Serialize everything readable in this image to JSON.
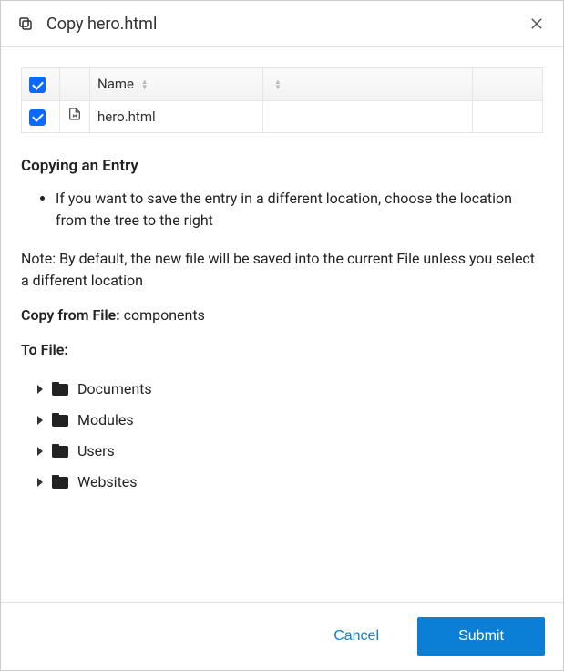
{
  "dialog": {
    "title": "Copy hero.html"
  },
  "table": {
    "headers": {
      "name": "Name"
    },
    "rows": [
      {
        "checked": true,
        "filename": "hero.html"
      }
    ]
  },
  "help": {
    "heading": "Copying an Entry",
    "bullet1": "If you want to save the entry in a different location, choose the location from the tree to the right",
    "note": "Note: By default, the new file will be saved into the current File unless you select a different location"
  },
  "copyFrom": {
    "label": "Copy from File:",
    "value": "components"
  },
  "toFile": {
    "label": "To File:",
    "tree": [
      {
        "label": "Documents"
      },
      {
        "label": "Modules"
      },
      {
        "label": "Users"
      },
      {
        "label": "Websites"
      }
    ]
  },
  "actions": {
    "cancel": "Cancel",
    "submit": "Submit"
  }
}
